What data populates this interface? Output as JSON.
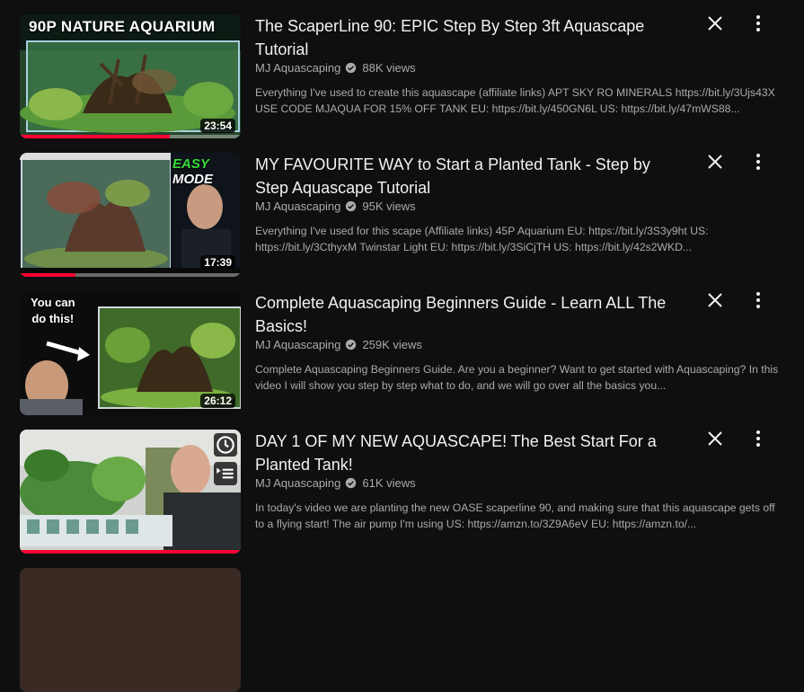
{
  "videos": [
    {
      "title": "The ScaperLine 90: EPIC Step By Step 3ft Aquascape Tutorial",
      "channel": "MJ Aquascaping",
      "views": "88K views",
      "description": "Everything I've used to create this aquascape (affiliate links) APT SKY RO MINERALS https://bit.ly/3Ujs43X USE CODE MJAQUA FOR 15% OFF TANK EU: https://bit.ly/450GN6L US: https://bit.ly/47mWS88...",
      "duration": "23:54",
      "overlay_text": "90P NATURE AQUARIUM",
      "watched_fraction": 0.68
    },
    {
      "title": "MY FAVOURITE WAY to Start a Planted Tank - Step by Step Aquascape Tutorial",
      "channel": "MJ Aquascaping",
      "views": "95K views",
      "description": "Everything I've used for this scape (Affiliate links) 45P Aquarium EU: https://bit.ly/3S3y9ht US: https://bit.ly/3CthyxM Twinstar Light EU: https://bit.ly/3SiCjTH US: https://bit.ly/42s2WKD...",
      "duration": "17:39",
      "overlay_text_1": "EASY",
      "overlay_text_2": "MODE",
      "watched_fraction": 0.25
    },
    {
      "title": "Complete Aquascaping Beginners Guide - Learn ALL The Basics!",
      "channel": "MJ Aquascaping",
      "views": "259K views",
      "description": "Complete Aquascaping Beginners Guide. Are you a beginner? Want to get started with Aquascaping? In this video I will show you step by step what to do, and we will go over all the basics you...",
      "duration": "26:12",
      "overlay_text_1": "You can",
      "overlay_text_2": "do this!",
      "watched_fraction": 0.0
    },
    {
      "title": "DAY 1 OF MY NEW AQUASCAPE! The Best Start For a Planted Tank!",
      "channel": "MJ Aquascaping",
      "views": "61K views",
      "description": "In today's video we are planting the new OASE scaperline 90, and making sure that this aquascape gets off to a flying start! The air pump I'm using US: https://amzn.to/3Z9A6eV EU: https://amzn.to/...",
      "watched_fraction": 1.0
    }
  ],
  "colors": {
    "background": "#0f0f0f",
    "progress": "#ff0033",
    "text": "#f1f1f1",
    "secondary": "#aaaaaa"
  },
  "icons": {
    "close": "close-icon",
    "more": "more-vert-icon",
    "verified": "verified-check-icon",
    "watch_later": "clock-icon",
    "add_to_queue": "queue-icon"
  }
}
